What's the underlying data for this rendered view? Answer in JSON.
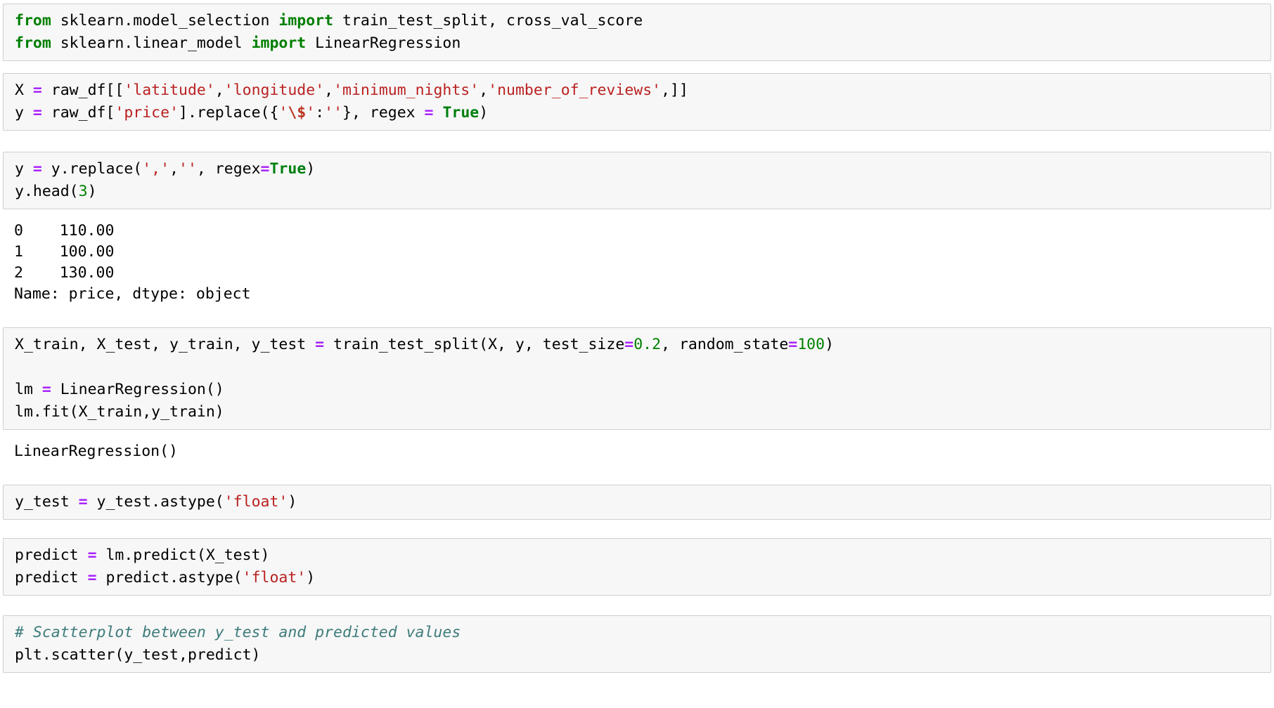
{
  "notebook": {
    "kind": "jupyter-notebook",
    "colors": {
      "cell_background": "#f7f7f7",
      "cell_border": "#cfcfcf",
      "page_background": "#ffffff",
      "keyword": "#007f00",
      "operator": "#aa22ff",
      "string": "#ba2121",
      "escape": "#bb3622",
      "number": "#008000",
      "comment": "#3d7b7b",
      "text": "#000000"
    },
    "cells": [
      {
        "id": "cell-imports",
        "type": "code",
        "lines": [
          [
            {
              "t": "from",
              "c": "kw"
            },
            {
              "t": " sklearn.model_selection ",
              "c": "plain"
            },
            {
              "t": "import",
              "c": "kw"
            },
            {
              "t": " train_test_split, cross_val_score",
              "c": "plain"
            }
          ],
          [
            {
              "t": "from",
              "c": "kw"
            },
            {
              "t": " sklearn.linear_model ",
              "c": "plain"
            },
            {
              "t": "import",
              "c": "kw"
            },
            {
              "t": " LinearRegression",
              "c": "plain"
            }
          ]
        ]
      },
      {
        "id": "cell-features",
        "type": "code",
        "lines": [
          [
            {
              "t": "X ",
              "c": "plain"
            },
            {
              "t": "=",
              "c": "op"
            },
            {
              "t": " raw_df[[",
              "c": "plain"
            },
            {
              "t": "'latitude'",
              "c": "str"
            },
            {
              "t": ",",
              "c": "plain"
            },
            {
              "t": "'longitude'",
              "c": "str"
            },
            {
              "t": ",",
              "c": "plain"
            },
            {
              "t": "'minimum_nights'",
              "c": "str"
            },
            {
              "t": ",",
              "c": "plain"
            },
            {
              "t": "'number_of_reviews'",
              "c": "str"
            },
            {
              "t": ",]]",
              "c": "plain"
            }
          ],
          [
            {
              "t": "y ",
              "c": "plain"
            },
            {
              "t": "=",
              "c": "op"
            },
            {
              "t": " raw_df[",
              "c": "plain"
            },
            {
              "t": "'price'",
              "c": "str"
            },
            {
              "t": "].replace({",
              "c": "plain"
            },
            {
              "t": "'",
              "c": "str"
            },
            {
              "t": "\\$",
              "c": "esc"
            },
            {
              "t": "'",
              "c": "str"
            },
            {
              "t": ":",
              "c": "plain"
            },
            {
              "t": "''",
              "c": "str"
            },
            {
              "t": "}, regex ",
              "c": "plain"
            },
            {
              "t": "=",
              "c": "op"
            },
            {
              "t": " ",
              "c": "plain"
            },
            {
              "t": "True",
              "c": "const"
            },
            {
              "t": ")",
              "c": "plain"
            }
          ]
        ]
      },
      {
        "id": "cell-replace-comma",
        "type": "code",
        "lines": [
          [
            {
              "t": "y ",
              "c": "plain"
            },
            {
              "t": "=",
              "c": "op"
            },
            {
              "t": " y.replace(",
              "c": "plain"
            },
            {
              "t": "','",
              "c": "str"
            },
            {
              "t": ",",
              "c": "plain"
            },
            {
              "t": "''",
              "c": "str"
            },
            {
              "t": ", regex",
              "c": "plain"
            },
            {
              "t": "=",
              "c": "op"
            },
            {
              "t": "True",
              "c": "const"
            },
            {
              "t": ")",
              "c": "plain"
            }
          ],
          [
            {
              "t": "y.head(",
              "c": "plain"
            },
            {
              "t": "3",
              "c": "num"
            },
            {
              "t": ")",
              "c": "plain"
            }
          ]
        ]
      },
      {
        "id": "output-head",
        "type": "output",
        "lines": [
          [
            {
              "t": "0    110.00",
              "c": "plain"
            }
          ],
          [
            {
              "t": "1    100.00",
              "c": "plain"
            }
          ],
          [
            {
              "t": "2    130.00",
              "c": "plain"
            }
          ],
          [
            {
              "t": "Name: price, dtype: object",
              "c": "plain"
            }
          ]
        ]
      },
      {
        "id": "cell-train-test-split",
        "type": "code",
        "lines": [
          [
            {
              "t": "X_train, X_test, y_train, y_test ",
              "c": "plain"
            },
            {
              "t": "=",
              "c": "op"
            },
            {
              "t": " train_test_split(X, y, test_size",
              "c": "plain"
            },
            {
              "t": "=",
              "c": "op"
            },
            {
              "t": "0.2",
              "c": "num"
            },
            {
              "t": ", random_state",
              "c": "plain"
            },
            {
              "t": "=",
              "c": "op"
            },
            {
              "t": "100",
              "c": "num"
            },
            {
              "t": ")",
              "c": "plain"
            }
          ],
          [],
          [
            {
              "t": "lm ",
              "c": "plain"
            },
            {
              "t": "=",
              "c": "op"
            },
            {
              "t": " LinearRegression()",
              "c": "plain"
            }
          ],
          [
            {
              "t": "lm.fit(X_train,y_train)",
              "c": "plain"
            }
          ]
        ]
      },
      {
        "id": "output-linear-regression",
        "type": "output",
        "lines": [
          [
            {
              "t": "LinearRegression()",
              "c": "plain"
            }
          ]
        ]
      },
      {
        "id": "cell-ytest-astype",
        "type": "code",
        "lines": [
          [
            {
              "t": "y_test ",
              "c": "plain"
            },
            {
              "t": "=",
              "c": "op"
            },
            {
              "t": " y_test.astype(",
              "c": "plain"
            },
            {
              "t": "'float'",
              "c": "str"
            },
            {
              "t": ")",
              "c": "plain"
            }
          ]
        ]
      },
      {
        "id": "cell-predict",
        "type": "code",
        "lines": [
          [
            {
              "t": "predict ",
              "c": "plain"
            },
            {
              "t": "=",
              "c": "op"
            },
            {
              "t": " lm.predict(X_test)",
              "c": "plain"
            }
          ],
          [
            {
              "t": "predict ",
              "c": "plain"
            },
            {
              "t": "=",
              "c": "op"
            },
            {
              "t": " predict.astype(",
              "c": "plain"
            },
            {
              "t": "'float'",
              "c": "str"
            },
            {
              "t": ")",
              "c": "plain"
            }
          ]
        ]
      },
      {
        "id": "cell-scatter",
        "type": "code",
        "lines": [
          [
            {
              "t": "# Scatterplot between y_test and predicted values",
              "c": "com"
            }
          ],
          [
            {
              "t": "plt.scatter(y_test,predict)",
              "c": "plain"
            }
          ]
        ]
      }
    ]
  }
}
